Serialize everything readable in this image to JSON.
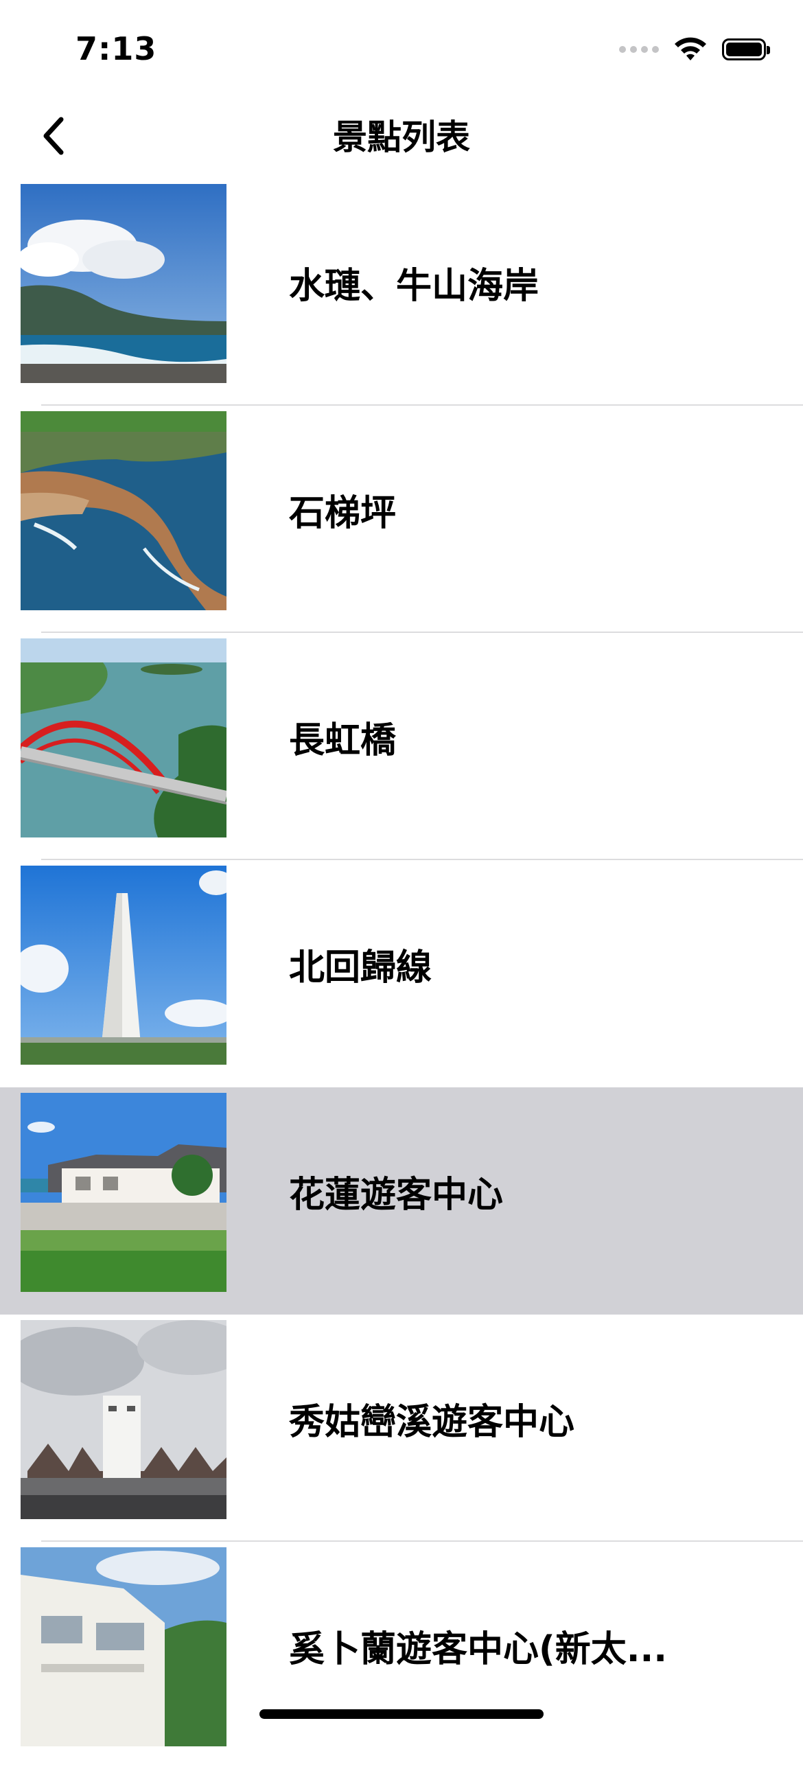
{
  "status_bar": {
    "time": "7:13"
  },
  "nav": {
    "title": "景點列表",
    "back_icon": "chevron-left-icon"
  },
  "list": {
    "items": [
      {
        "label": "水璉、牛山海岸",
        "image": "coast-landscape-photo"
      },
      {
        "label": "石梯坪",
        "image": "rocky-shore-aerial-photo"
      },
      {
        "label": "長虹橋",
        "image": "red-arch-bridge-photo"
      },
      {
        "label": "北回歸線",
        "image": "white-tower-monument-photo"
      },
      {
        "label": "花蓮遊客中心",
        "image": "visitor-center-building-photo",
        "selected": true
      },
      {
        "label": "秀姑巒溪遊客中心",
        "image": "totem-visitor-center-photo"
      },
      {
        "label": "奚卜蘭遊客中心(新太...",
        "image": "white-building-photo"
      }
    ]
  },
  "colors": {
    "selected_row": "#d1d1d6",
    "separator": "#dcdcde"
  }
}
